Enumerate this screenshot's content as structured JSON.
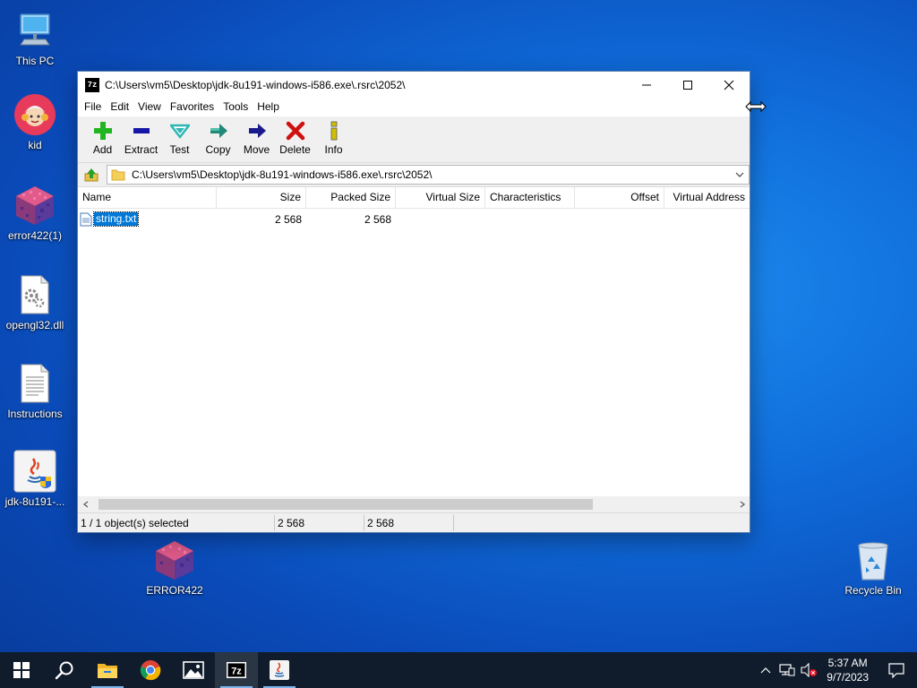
{
  "desktop": {
    "icons": [
      {
        "label": "This PC",
        "icon": "this-pc-icon"
      },
      {
        "label": "kid",
        "icon": "kid-avatar-icon"
      },
      {
        "label": "error422(1)",
        "icon": "error-cube-icon"
      },
      {
        "label": "opengl32.dll",
        "icon": "dll-file-icon"
      },
      {
        "label": "Instructions",
        "icon": "text-document-icon"
      },
      {
        "label": "jdk-8u191-...",
        "icon": "java-installer-icon"
      },
      {
        "label": "ERROR422",
        "icon": "error-cube-icon"
      },
      {
        "label": "Recycle Bin",
        "icon": "recycle-bin-icon"
      }
    ]
  },
  "window": {
    "app_icon_text": "7z",
    "title": "C:\\Users\\vm5\\Desktop\\jdk-8u191-windows-i586.exe\\.rsrc\\2052\\",
    "menu": [
      "File",
      "Edit",
      "View",
      "Favorites",
      "Tools",
      "Help"
    ],
    "toolbar": [
      {
        "label": "Add",
        "icon": "add-icon",
        "color": "#22b522"
      },
      {
        "label": "Extract",
        "icon": "extract-icon",
        "color": "#1515a8"
      },
      {
        "label": "Test",
        "icon": "test-icon",
        "color": "#2fb6b6"
      },
      {
        "label": "Copy",
        "icon": "copy-icon",
        "color": "#1f8a7a"
      },
      {
        "label": "Move",
        "icon": "move-icon",
        "color": "#1a1a8c"
      },
      {
        "label": "Delete",
        "icon": "delete-icon",
        "color": "#d01010"
      },
      {
        "label": "Info",
        "icon": "info-icon",
        "color": "#d0c000"
      }
    ],
    "address": "C:\\Users\\vm5\\Desktop\\jdk-8u191-windows-i586.exe\\.rsrc\\2052\\",
    "columns": [
      "Name",
      "Size",
      "Packed Size",
      "Virtual Size",
      "Characteristics",
      "Offset",
      "Virtual Address"
    ],
    "rows": [
      {
        "name": "string.txt",
        "size": "2 568",
        "packed_size": "2 568",
        "virtual_size": "",
        "characteristics": "",
        "offset": "",
        "virtual_address": ""
      }
    ],
    "status": {
      "selection": "1 / 1 object(s) selected",
      "size": "2 568",
      "packed": "2 568"
    }
  },
  "taskbar": {
    "apps": [
      "start-icon",
      "search-icon",
      "file-explorer-icon",
      "chrome-icon",
      "photos-icon",
      "7zip-icon",
      "java-icon"
    ],
    "clock_time": "5:37 AM",
    "clock_date": "9/7/2023"
  },
  "colors": {
    "selection": "#0078d7",
    "taskbar": "#101c2c"
  }
}
